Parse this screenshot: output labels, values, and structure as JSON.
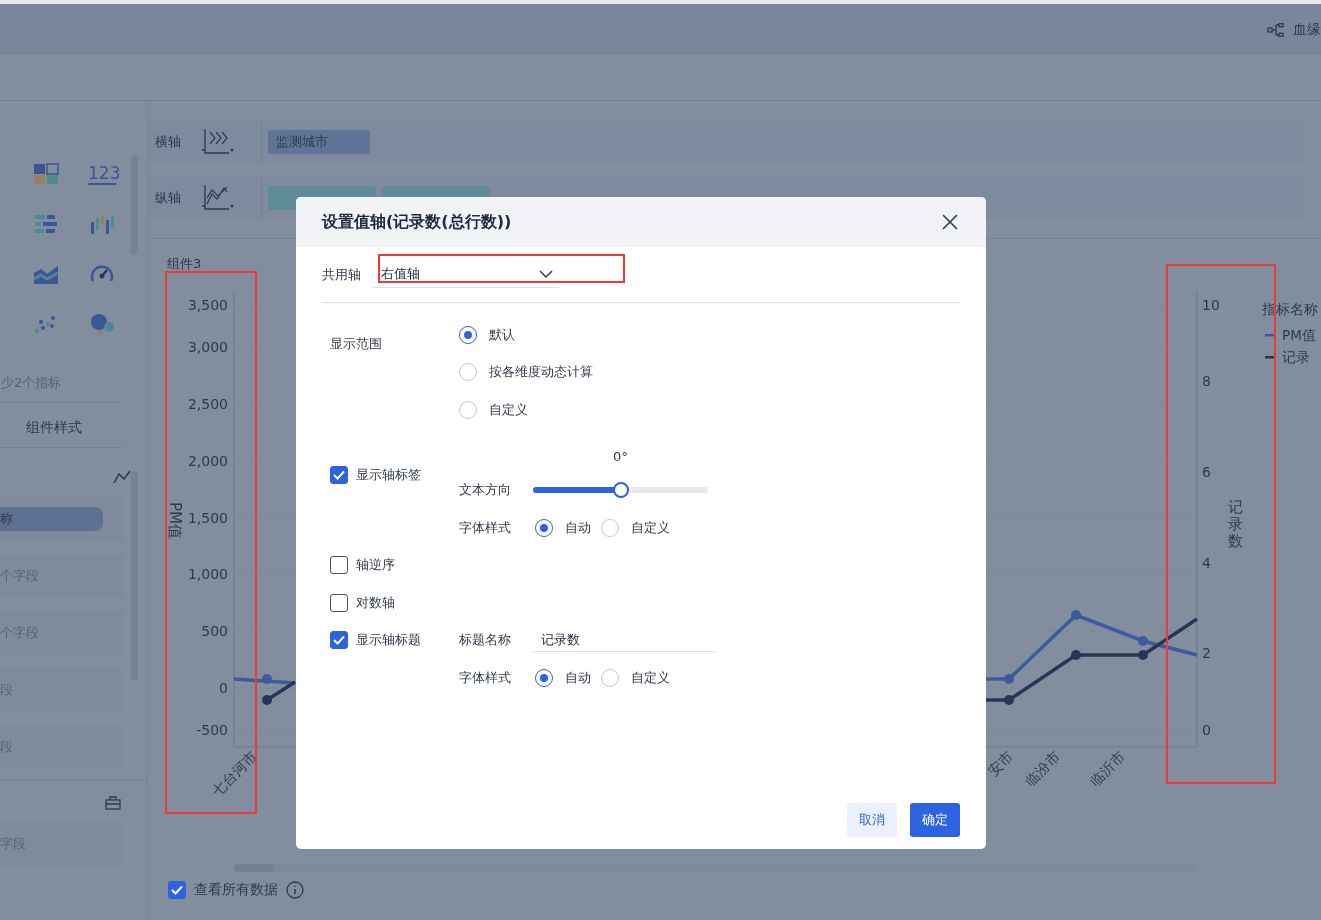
{
  "top_bar": {
    "link": "血缘"
  },
  "sidebar": {
    "chart_types": [
      {
        "kind": "tiles"
      },
      {
        "kind": "number",
        "label": "123"
      },
      {
        "kind": "hbar"
      },
      {
        "kind": "vbar"
      },
      {
        "kind": "area"
      },
      {
        "kind": "gauge"
      },
      {
        "kind": "scatter"
      },
      {
        "kind": "bubble"
      }
    ],
    "hint": "少2个指标",
    "section": "组件样式",
    "fields": [
      {
        "label": "称",
        "selected": true
      },
      {
        "label": "个字段",
        "selected": false
      },
      {
        "label": "个字段",
        "selected": false
      },
      {
        "label": "段",
        "selected": false
      },
      {
        "label": "段",
        "selected": false
      }
    ],
    "bottom_field": "字段"
  },
  "axes": [
    {
      "label": "横轴",
      "kind": "x",
      "pills": [
        {
          "kind": "dimension",
          "text": "监测城市"
        }
      ]
    },
    {
      "label": "纵轴",
      "kind": "y",
      "pills": [
        {
          "kind": "measure"
        },
        {
          "kind": "measure"
        }
      ]
    }
  ],
  "chart": {
    "title": "组件3",
    "left_axis": {
      "title": "PM值",
      "ticks": [
        "3,500",
        "3,000",
        "2,500",
        "2,000",
        "1,500",
        "1,000",
        "500",
        "0",
        "-500"
      ]
    },
    "right_axis": {
      "title": "记录数",
      "ticks": [
        "10",
        "8",
        "6",
        "4",
        "2",
        "0"
      ]
    },
    "categories": [
      "七台河市",
      "安市",
      "临汾市",
      "临沂市"
    ],
    "legend": {
      "title": "指标名称",
      "items": [
        {
          "name": "PM值",
          "color": "#3d5a9e"
        },
        {
          "name": "记录",
          "color": "#263656"
        }
      ]
    },
    "footer": {
      "label": "查看所有数据",
      "checked": true
    }
  },
  "dialog": {
    "title": "设置值轴(记录数(总行数))",
    "shared_axis": {
      "label": "共用轴",
      "value": "右值轴"
    },
    "range": {
      "label": "显示范围",
      "options": [
        {
          "label": "默认",
          "selected": true
        },
        {
          "label": "按各维度动态计算",
          "selected": false
        },
        {
          "label": "自定义",
          "selected": false
        }
      ]
    },
    "axis_labels": {
      "label": "显示轴标签",
      "checked": true,
      "angle": "0°",
      "direction_label": "文本方向",
      "level": 0.5,
      "font_label": "字体样式",
      "font_options": [
        {
          "label": "自动",
          "selected": true
        },
        {
          "label": "自定义",
          "selected": false
        }
      ]
    },
    "reverse": {
      "label": "轴逆序",
      "checked": false
    },
    "log": {
      "label": "对数轴",
      "checked": false
    },
    "axis_title": {
      "label": "显示轴标题",
      "checked": true,
      "name_label": "标题名称",
      "name_value": "记录数",
      "font_label": "字体样式",
      "font_options": [
        {
          "label": "自动",
          "selected": true
        },
        {
          "label": "自定义",
          "selected": false
        }
      ]
    },
    "buttons": [
      {
        "label": "取消",
        "kind": "secondary"
      },
      {
        "label": "确定",
        "kind": "primary"
      }
    ]
  },
  "highlights": [
    {
      "kind": "select"
    },
    {
      "kind": "left_axis"
    },
    {
      "kind": "right_axis"
    }
  ]
}
